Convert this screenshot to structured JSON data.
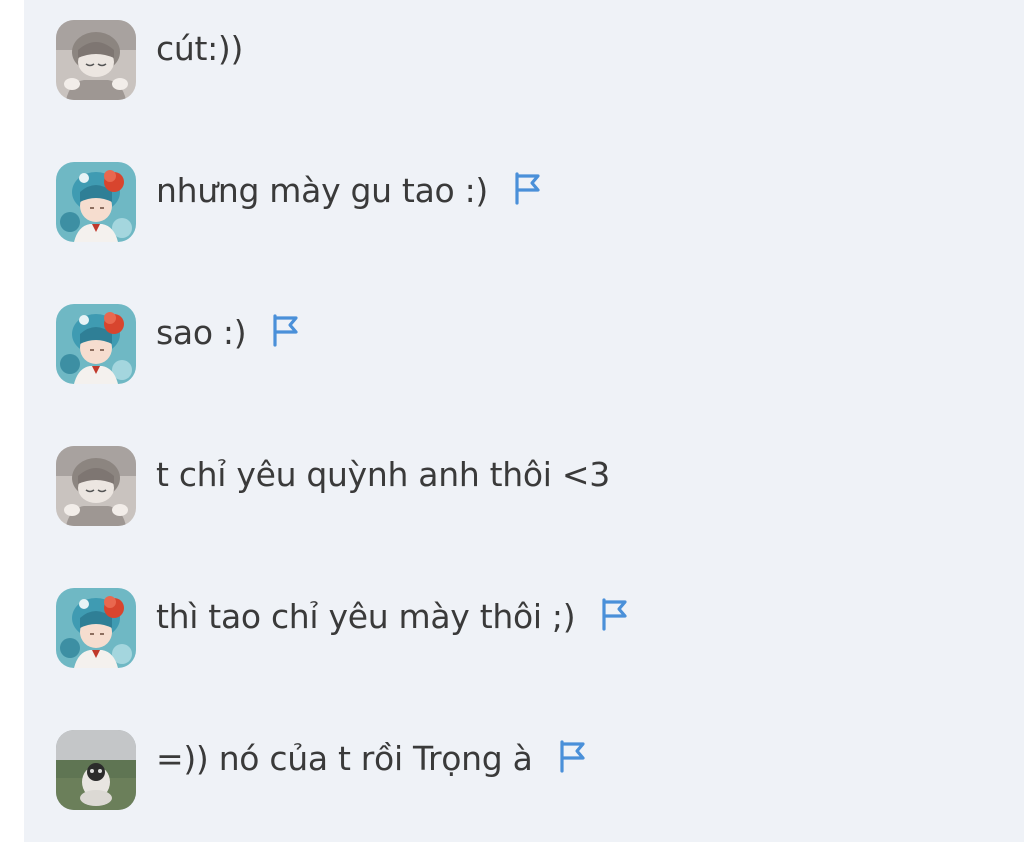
{
  "messages": [
    {
      "text": "cút:))",
      "avatar": "gray-child-avatar",
      "flag": false
    },
    {
      "text": "nhưng mày gu tao :)",
      "avatar": "teal-flower-avatar",
      "flag": true
    },
    {
      "text": "sao :)",
      "avatar": "teal-flower-avatar",
      "flag": true
    },
    {
      "text": "t chỉ yêu quỳnh anh thôi <3",
      "avatar": "gray-child-avatar",
      "flag": false
    },
    {
      "text": "thì tao chỉ yêu mày thôi ;)",
      "avatar": "teal-flower-avatar",
      "flag": true
    },
    {
      "text": "=)) nó của t rồi Trọng à",
      "avatar": "landscape-dog-avatar",
      "flag": true
    }
  ],
  "colors": {
    "panel_bg": "#eff2f7",
    "text": "#3a3a3a",
    "flag_blue": "#4a90d9"
  },
  "icons": {
    "report": "flag-icon"
  }
}
